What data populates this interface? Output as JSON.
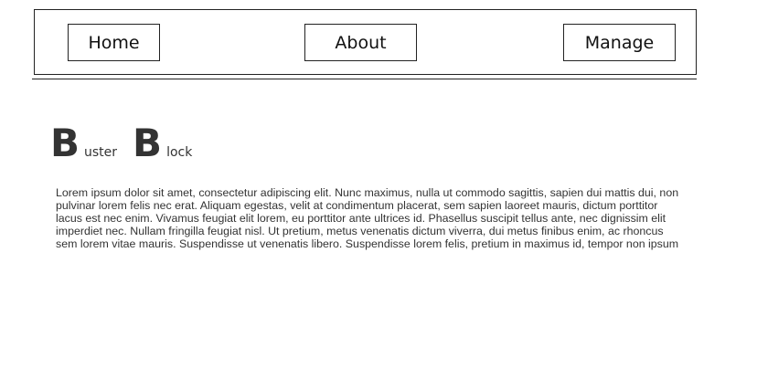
{
  "nav": {
    "home_label": "Home",
    "about_label": "About",
    "manage_label": "Manage"
  },
  "logo": {
    "letter1": "B",
    "word1": "uster",
    "letter2": "B",
    "word2": "lock"
  },
  "content": {
    "paragraph": "Lorem ipsum dolor sit amet, consectetur adipiscing elit. Nunc maximus, nulla ut commodo sagittis, sapien dui mattis dui, non pulvinar lorem felis nec erat. Aliquam egestas, velit at condimentum placerat, sem sapien laoreet mauris, dictum porttitor lacus est nec enim. Vivamus feugiat elit lorem, eu porttitor ante ultrices id. Phasellus suscipit tellus ante, nec dignissim elit imperdiet nec. Nullam fringilla feugiat nisl. Ut pretium, metus venenatis dictum viverra, dui metus finibus enim, ac rhoncus sem lorem vitae mauris. Suspendisse ut venenatis libero. Suspendisse lorem felis, pretium in maximus id, tempor non ipsum"
  }
}
